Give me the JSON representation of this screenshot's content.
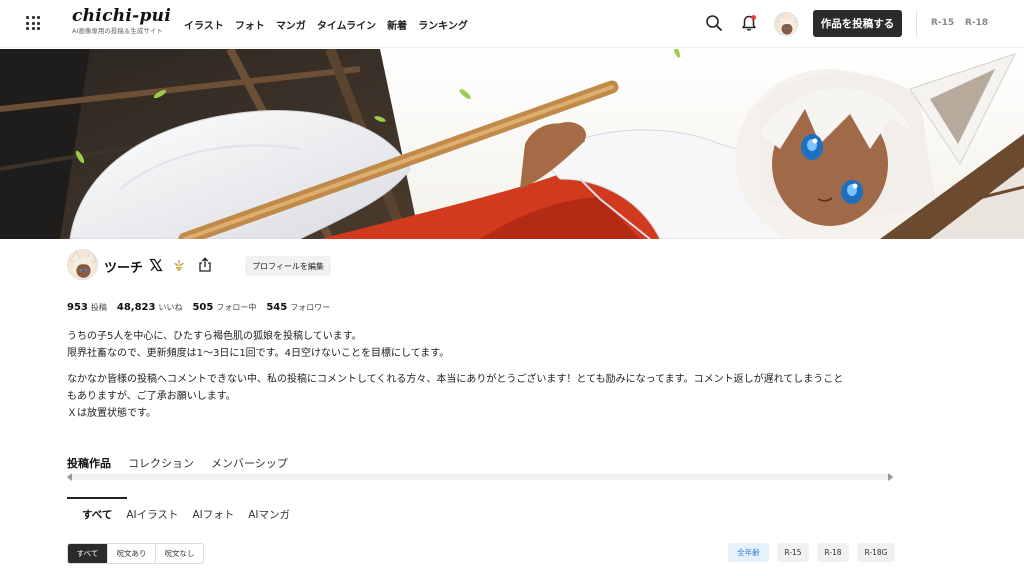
{
  "header": {
    "logo_text": "chichi-pui",
    "logo_subtitle": "AI画像専用の投稿＆生成サイト",
    "nav": [
      "イラスト",
      "フォト",
      "マンガ",
      "タイムライン",
      "新着",
      "ランキング"
    ],
    "post_button": "作品を投稿する",
    "ratings": [
      "R-15",
      "R-18"
    ],
    "icons": {
      "menu": "grid-icon",
      "search": "search-icon",
      "notifications": "bell-icon"
    }
  },
  "profile": {
    "name": "ツーチ",
    "edit_button": "プロフィールを編集",
    "stats": [
      {
        "value": "953",
        "label": "投稿"
      },
      {
        "value": "48,823",
        "label": "いいね"
      },
      {
        "value": "505",
        "label": "フォロー中"
      },
      {
        "value": "545",
        "label": "フォロワー"
      }
    ],
    "bio": {
      "line1": "うちの子5人を中心に、ひたすら褐色肌の狐娘を投稿しています。",
      "line2": "限界社畜なので、更新頻度は1〜3日に1回です。4日空けないことを目標にしてます。",
      "line3": "なかなか皆様の投稿へコメントできない中、私の投稿にコメントしてくれる方々、本当にありがとうございます！とても励みになってます。コメント返しが遅れてしまうこと",
      "line4": "もありますが、ご了承お願いします。",
      "line5": "Ｘは放置状態です。"
    }
  },
  "tabs": {
    "main": [
      "投稿作品",
      "コレクション",
      "メンバーシップ"
    ],
    "sub": [
      "すべて",
      "AIイラスト",
      "AIフォト",
      "AIマンガ"
    ]
  },
  "filters": {
    "prompt": [
      "すべて",
      "呪文あり",
      "呪文なし"
    ],
    "rating": [
      "全年齢",
      "R-15",
      "R-18",
      "R-18G"
    ]
  },
  "colors": {
    "accent_dark": "#2b2b2b",
    "rating_active_bg": "#e7f1fb",
    "rating_active_text": "#2a7bd0"
  }
}
